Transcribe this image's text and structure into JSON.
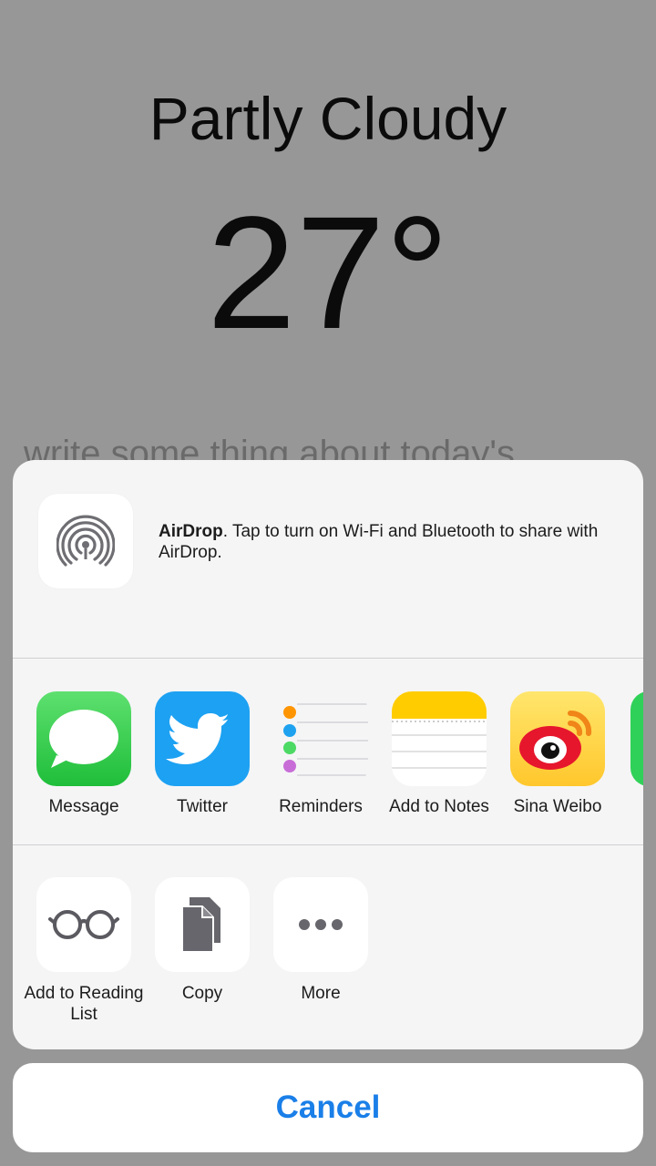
{
  "background": {
    "title": "Partly Cloudy",
    "temperature": "27°",
    "note_placeholder": "write some thing about today's"
  },
  "airdrop": {
    "title": "AirDrop",
    "description": ". Tap to turn on Wi-Fi and Bluetooth to share with AirDrop.",
    "icon": "airdrop-icon"
  },
  "share_apps": [
    {
      "label": "Message",
      "icon": "message-icon",
      "color": "#34c759"
    },
    {
      "label": "Twitter",
      "icon": "twitter-icon",
      "color": "#1da1f2"
    },
    {
      "label": "Reminders",
      "icon": "reminders-icon",
      "color": "#ffffff"
    },
    {
      "label": "Add to Notes",
      "icon": "notes-icon",
      "color": "#ffd60a"
    },
    {
      "label": "Sina Weibo",
      "icon": "weibo-icon",
      "color": "#ffd23f"
    }
  ],
  "actions": [
    {
      "label": "Add to Reading List",
      "icon": "reading-glasses-icon"
    },
    {
      "label": "Copy",
      "icon": "copy-icon"
    },
    {
      "label": "More",
      "icon": "more-icon"
    }
  ],
  "cancel_label": "Cancel",
  "colors": {
    "accent": "#1a7fe8",
    "dim_overlay": "#979797",
    "sheet": "#f5f5f6"
  }
}
